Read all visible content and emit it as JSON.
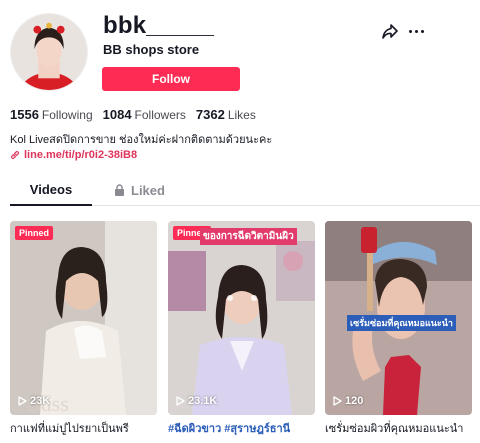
{
  "profile": {
    "username": "bbk_____",
    "nickname": "BB shops store",
    "follow_label": "Follow",
    "bio": "Kol Liveสดปิดการขาย ช่องใหม่ค่ะฝากติดตามด้วยนะคะ",
    "link": "line.me/ti/p/r0i2-38iB8"
  },
  "stats": {
    "following": {
      "value": "1556",
      "label": "Following"
    },
    "followers": {
      "value": "1084",
      "label": "Followers"
    },
    "likes": {
      "value": "7362",
      "label": "Likes"
    }
  },
  "tabs": {
    "videos": "Videos",
    "liked": "Liked"
  },
  "videos": [
    {
      "pinned": "Pinned",
      "views": "23K",
      "caption": "กาแฟที่แม่ปูไปรยาเป็นพรี",
      "overlay": ""
    },
    {
      "pinned": "Pinned",
      "views": "23.1K",
      "caption": "#ฉีดผิวขาว #สุราษฎร์ธานี",
      "overlay": "ของการฉีดวิตามินผิว"
    },
    {
      "pinned": "",
      "views": "120",
      "caption": "เซรั่มซ่อมผิวที่คุณหมอแนะนำ",
      "overlay": "เซรั่มซ่อมที่คุณหมอแนะนำ"
    }
  ],
  "colors": {
    "accent": "#fe2c55",
    "link": "#e0345b",
    "hashtag": "#2b5db9"
  }
}
